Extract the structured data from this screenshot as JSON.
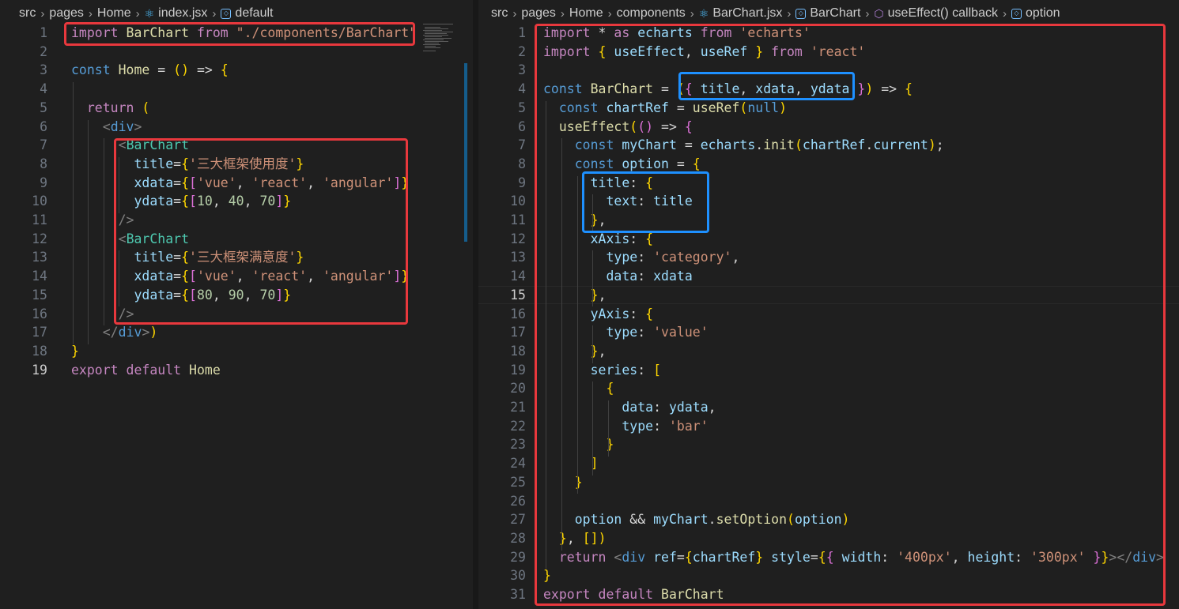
{
  "left": {
    "breadcrumb": {
      "items": [
        "src",
        "pages",
        "Home",
        "index.jsx",
        "default"
      ],
      "icons": [
        "react-icon",
        "symbol-icon"
      ]
    },
    "code": [
      {
        "n": "1",
        "t": "import BarChart from \"./components/BarChart\""
      },
      {
        "n": "2",
        "t": ""
      },
      {
        "n": "3",
        "t": "const Home = () => {"
      },
      {
        "n": "4",
        "t": ""
      },
      {
        "n": "5",
        "t": "  return ("
      },
      {
        "n": "6",
        "t": "    <div>"
      },
      {
        "n": "7",
        "t": "      <BarChart"
      },
      {
        "n": "8",
        "t": "        title={'三大框架使用度'}"
      },
      {
        "n": "9",
        "t": "        xdata={['vue', 'react', 'angular']}"
      },
      {
        "n": "10",
        "t": "        ydata={[10, 40, 70]}"
      },
      {
        "n": "11",
        "t": "      />"
      },
      {
        "n": "12",
        "t": "      <BarChart"
      },
      {
        "n": "13",
        "t": "        title={'三大框架满意度'}"
      },
      {
        "n": "14",
        "t": "        xdata={['vue', 'react', 'angular']}"
      },
      {
        "n": "15",
        "t": "        ydata={[80, 90, 70]}"
      },
      {
        "n": "16",
        "t": "      />"
      },
      {
        "n": "17",
        "t": "    </div>)"
      },
      {
        "n": "18",
        "t": "}"
      },
      {
        "n": "19",
        "t": "export default Home"
      }
    ],
    "active_line": "19"
  },
  "right": {
    "breadcrumb": {
      "items": [
        "src",
        "pages",
        "Home",
        "components",
        "BarChart.jsx",
        "BarChart",
        "useEffect() callback",
        "option"
      ],
      "icons": [
        "react-icon",
        "symbol-icon",
        "cube-icon",
        "symbol-icon"
      ]
    },
    "code": [
      {
        "n": "1",
        "t": "import * as echarts from 'echarts'"
      },
      {
        "n": "2",
        "t": "import { useEffect, useRef } from 'react'"
      },
      {
        "n": "3",
        "t": ""
      },
      {
        "n": "4",
        "t": "const BarChart = ({ title, xdata, ydata }) => {"
      },
      {
        "n": "5",
        "t": "  const chartRef = useRef(null)"
      },
      {
        "n": "6",
        "t": "  useEffect(() => {"
      },
      {
        "n": "7",
        "t": "    const myChart = echarts.init(chartRef.current);"
      },
      {
        "n": "8",
        "t": "    const option = {"
      },
      {
        "n": "9",
        "t": "      title: {"
      },
      {
        "n": "10",
        "t": "        text: title"
      },
      {
        "n": "11",
        "t": "      },"
      },
      {
        "n": "12",
        "t": "      xAxis: {"
      },
      {
        "n": "13",
        "t": "        type: 'category',"
      },
      {
        "n": "14",
        "t": "        data: xdata"
      },
      {
        "n": "15",
        "t": "      },"
      },
      {
        "n": "16",
        "t": "      yAxis: {"
      },
      {
        "n": "17",
        "t": "        type: 'value'"
      },
      {
        "n": "18",
        "t": "      },"
      },
      {
        "n": "19",
        "t": "      series: ["
      },
      {
        "n": "20",
        "t": "        {"
      },
      {
        "n": "21",
        "t": "          data: ydata,"
      },
      {
        "n": "22",
        "t": "          type: 'bar'"
      },
      {
        "n": "23",
        "t": "        }"
      },
      {
        "n": "24",
        "t": "      ]"
      },
      {
        "n": "25",
        "t": "    }"
      },
      {
        "n": "26",
        "t": ""
      },
      {
        "n": "27",
        "t": "    option && myChart.setOption(option)"
      },
      {
        "n": "28",
        "t": "  }, [])"
      },
      {
        "n": "29",
        "t": "  return <div ref={chartRef} style={{ width: '400px', height: '300px' }}></div>"
      },
      {
        "n": "30",
        "t": "}"
      },
      {
        "n": "31",
        "t": "export default BarChart"
      }
    ],
    "active_line": "15"
  },
  "colors": {
    "editor_bg": "#1f1f1f",
    "highlight_red": "#e8383d",
    "highlight_blue": "#1e90ff"
  }
}
